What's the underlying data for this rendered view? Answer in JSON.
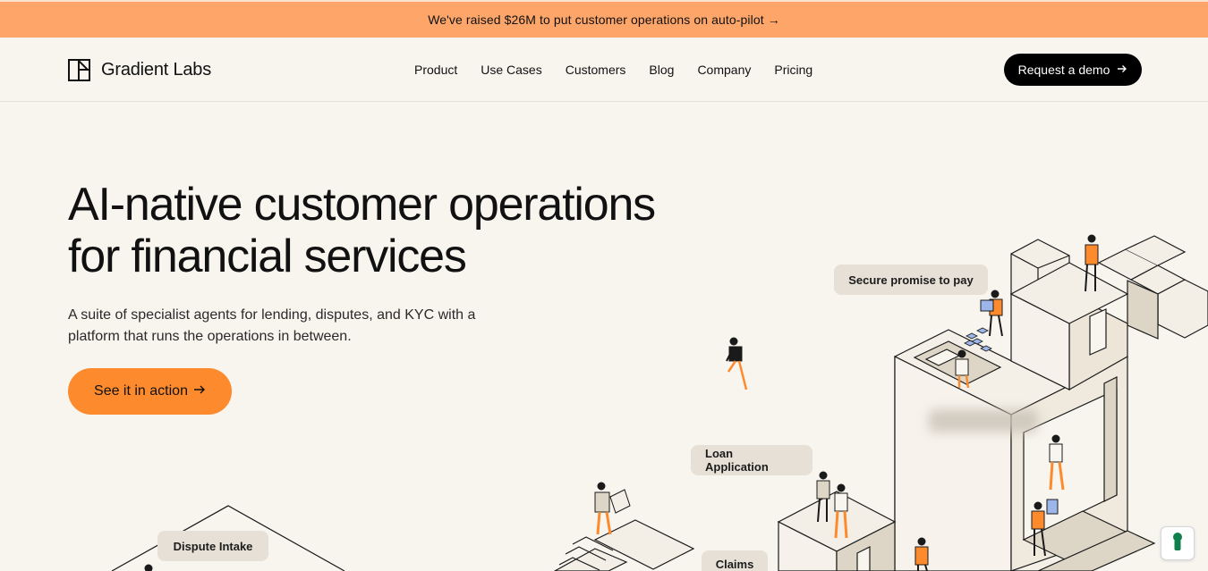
{
  "announcement": {
    "text": "We've raised $26M to put customer operations on auto-pilot →"
  },
  "brand": {
    "name": "Gradient Labs"
  },
  "nav": {
    "items": [
      {
        "label": "Product"
      },
      {
        "label": "Use Cases"
      },
      {
        "label": "Customers"
      },
      {
        "label": "Blog"
      },
      {
        "label": "Company"
      },
      {
        "label": "Pricing"
      }
    ],
    "cta_label": "Request a demo"
  },
  "hero": {
    "title_line1": "AI-native customer operations",
    "title_line2": "for financial services",
    "subtitle": "A suite of specialist agents for lending, disputes, and KYC with a platform that runs the operations in between.",
    "button_label": "See it in action"
  },
  "illustration_tags": {
    "secure": "Secure promise to pay",
    "loan": "Loan Application",
    "dispute": "Dispute Intake",
    "claims": "Claims"
  },
  "colors": {
    "banner": "#fea66a",
    "accent": "#fd8a2d",
    "background": "#f8f5ef",
    "dark": "#000000"
  },
  "icons": {
    "cookie": "keyhole-icon",
    "arrow": "arrow-right-icon"
  }
}
